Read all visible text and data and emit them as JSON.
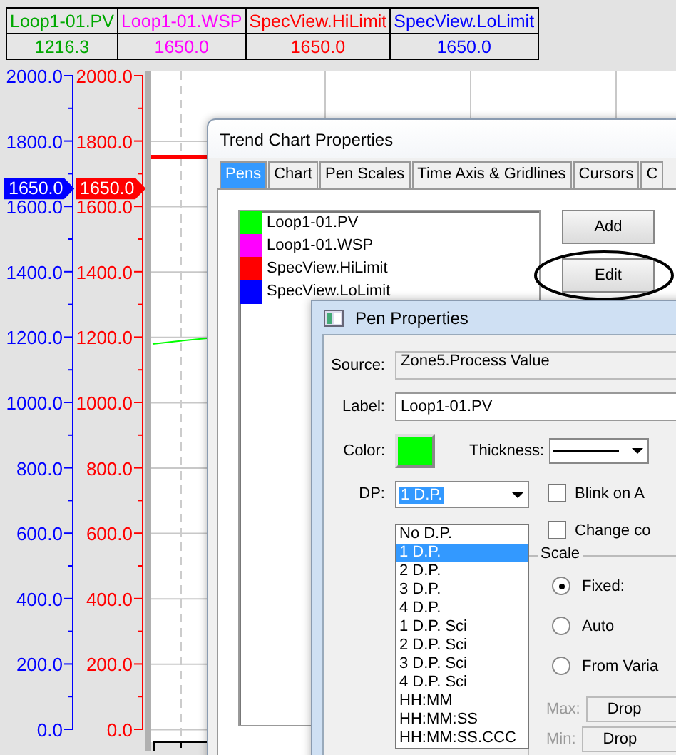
{
  "pen_table": [
    {
      "name": "Loop1-01.PV",
      "value": "1216.3",
      "color": "#00a800"
    },
    {
      "name": "Loop1-01.WSP",
      "value": "1650.0",
      "color": "#ff00ff"
    },
    {
      "name": "SpecView.HiLimit",
      "value": "1650.0",
      "color": "#ff0000"
    },
    {
      "name": "SpecView.LoLimit",
      "value": "1650.0",
      "color": "#0000ff"
    }
  ],
  "axes": [
    {
      "color": "#0000ff",
      "labels": [
        "2000.0",
        "1800.0",
        "1600.0",
        "1400.0",
        "1200.0",
        "1000.0",
        "800.0",
        "600.0",
        "400.0",
        "200.0",
        "0.0"
      ],
      "marker": "1650.0"
    },
    {
      "color": "#ff0000",
      "labels": [
        "2000.0",
        "1800.0",
        "1600.0",
        "1400.0",
        "1200.0",
        "1000.0",
        "800.0",
        "600.0",
        "400.0",
        "200.0",
        "0.0"
      ],
      "marker": "1650.0"
    }
  ],
  "trend_window": {
    "title": "Trend Chart Properties",
    "tabs": [
      {
        "label": "Pens",
        "selected": true
      },
      {
        "label": "Chart",
        "selected": false
      },
      {
        "label": "Pen Scales",
        "selected": false
      },
      {
        "label": "Time Axis & Gridlines",
        "selected": false
      },
      {
        "label": "Cursors",
        "selected": false
      },
      {
        "label": "C",
        "selected": false
      }
    ],
    "pens": [
      {
        "label": "Loop1-01.PV",
        "color": "#00ff00"
      },
      {
        "label": "Loop1-01.WSP",
        "color": "#ff00ff"
      },
      {
        "label": "SpecView.HiLimit",
        "color": "#ff0000"
      },
      {
        "label": "SpecView.LoLimit",
        "color": "#0000ff"
      }
    ],
    "buttons": [
      "Add",
      "Edit"
    ]
  },
  "pen_window": {
    "title": "Pen Properties",
    "source_label": "Source:",
    "source": "Zone5.Process Value",
    "label_label": "Label:",
    "label_value": "Loop1-01.PV",
    "color_label": "Color:",
    "color": "#00ff00",
    "thickness_label": "Thickness:",
    "dp_label": "DP:",
    "dp_value": "1 D.P.",
    "dp_options": [
      {
        "label": "No D.P.",
        "selected": false
      },
      {
        "label": "1 D.P.",
        "selected": true
      },
      {
        "label": "2 D.P.",
        "selected": false
      },
      {
        "label": "3 D.P.",
        "selected": false
      },
      {
        "label": "4 D.P.",
        "selected": false
      },
      {
        "label": "1 D.P. Sci",
        "selected": false
      },
      {
        "label": "2 D.P. Sci",
        "selected": false
      },
      {
        "label": "3 D.P. Sci",
        "selected": false
      },
      {
        "label": "4 D.P. Sci",
        "selected": false
      },
      {
        "label": "HH:MM",
        "selected": false
      },
      {
        "label": "HH:MM:SS",
        "selected": false
      },
      {
        "label": "HH:MM:SS.CCC",
        "selected": false
      }
    ],
    "checkboxes": [
      {
        "label": "Blink on A",
        "checked": false
      },
      {
        "label": "Change co",
        "checked": false
      }
    ],
    "scale": {
      "title": "Scale",
      "options": [
        {
          "label": "Fixed:",
          "selected": true
        },
        {
          "label": "Auto",
          "selected": false
        },
        {
          "label": "From Varia",
          "selected": false
        }
      ],
      "max_label": "Max:",
      "max_value": "Drop",
      "min_label": "Min:",
      "min_value": "Drop"
    }
  }
}
